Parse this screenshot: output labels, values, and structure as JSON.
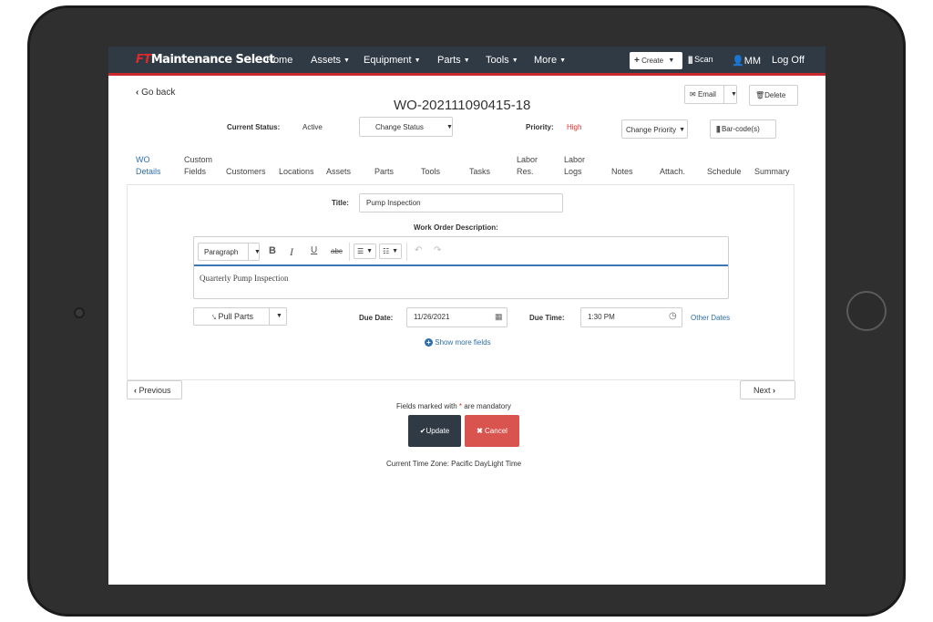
{
  "navbar": {
    "brand_ft": "FT",
    "brand_rest": "Maintenance Select",
    "items": [
      "Home",
      "Assets",
      "Equipment",
      "Parts",
      "Tools",
      "More"
    ],
    "create_label": "Create",
    "scan_label": "Scan",
    "user_label": "MM",
    "logoff_label": "Log Off"
  },
  "header": {
    "go_back": "Go back",
    "work_order_id": "WO-202111090415-18",
    "email_label": "Email",
    "delete_label": "Delete",
    "current_status_label": "Current Status:",
    "current_status_value": "Active",
    "change_status_label": "Change Status",
    "priority_label": "Priority:",
    "priority_value": "High",
    "change_priority_label": "Change Priority",
    "barcode_label": "Bar-code(s)"
  },
  "tabs": [
    {
      "l1": "WO",
      "l2": "Details"
    },
    {
      "l1": "Custom",
      "l2": "Fields"
    },
    {
      "l1": "",
      "l2": "Customers"
    },
    {
      "l1": "",
      "l2": "Locations"
    },
    {
      "l1": "",
      "l2": "Assets"
    },
    {
      "l1": "",
      "l2": "Parts"
    },
    {
      "l1": "",
      "l2": "Tools"
    },
    {
      "l1": "",
      "l2": "Tasks"
    },
    {
      "l1": "Labor",
      "l2": "Res."
    },
    {
      "l1": "Labor",
      "l2": "Logs"
    },
    {
      "l1": "",
      "l2": "Notes"
    },
    {
      "l1": "",
      "l2": "Attach."
    },
    {
      "l1": "",
      "l2": "Schedule"
    },
    {
      "l1": "",
      "l2": "Summary"
    }
  ],
  "form": {
    "title_label": "Title:",
    "title_value": "Pump Inspection",
    "description_label": "Work Order Description:",
    "paragraph_label": "Paragraph",
    "description_value": "Quarterly Pump Inspection",
    "pull_parts_label": "Pull Parts",
    "due_date_label": "Due Date:",
    "due_date_value": "11/26/2021",
    "due_time_label": "Due Time:",
    "due_time_value": "1:30 PM",
    "other_dates_label": "Other Dates",
    "show_more_label": "Show more fields"
  },
  "footer": {
    "previous_label": "Previous",
    "next_label": "Next",
    "mandatory_prefix": "Fields marked with ",
    "mandatory_star": "*",
    "mandatory_suffix": " are mandatory",
    "update_label": "Update",
    "cancel_label": "Cancel",
    "timezone_text": "Current Time Zone: Pacific DayLight Time"
  },
  "colors": {
    "navbar_bg": "#2f3a45",
    "accent_red": "#c9282d",
    "link_blue": "#2f6fa8",
    "cancel_red": "#d9534f"
  }
}
